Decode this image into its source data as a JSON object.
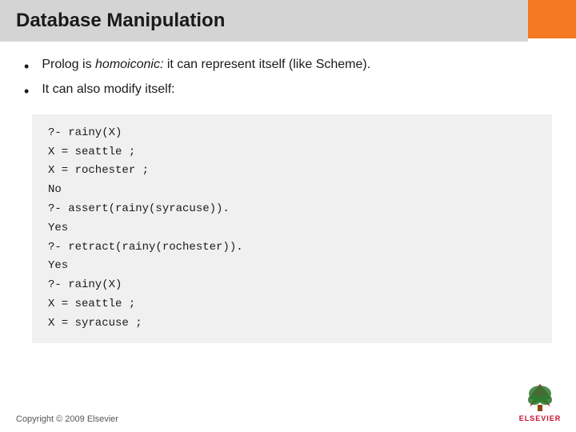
{
  "slide": {
    "accent_block": true,
    "title": "Database Manipulation",
    "bullets": [
      {
        "text_before": "Prolog is ",
        "text_italic": "homoiconic:",
        "text_after": " it can represent itself (like Scheme)."
      },
      {
        "text": "It can also modify itself:"
      }
    ],
    "code_lines": [
      "?- rainy(X)",
      "X = seattle ;",
      "X = rochester ;",
      "No",
      "?- assert(rainy(syracuse)).",
      "Yes",
      "?- retract(rainy(rochester)).",
      "Yes",
      "?- rainy(X)",
      "X = seattle ;",
      "X = syracuse ;"
    ],
    "footer": "Copyright © 2009 Elsevier",
    "elsevier_label": "ELSEVIER"
  }
}
